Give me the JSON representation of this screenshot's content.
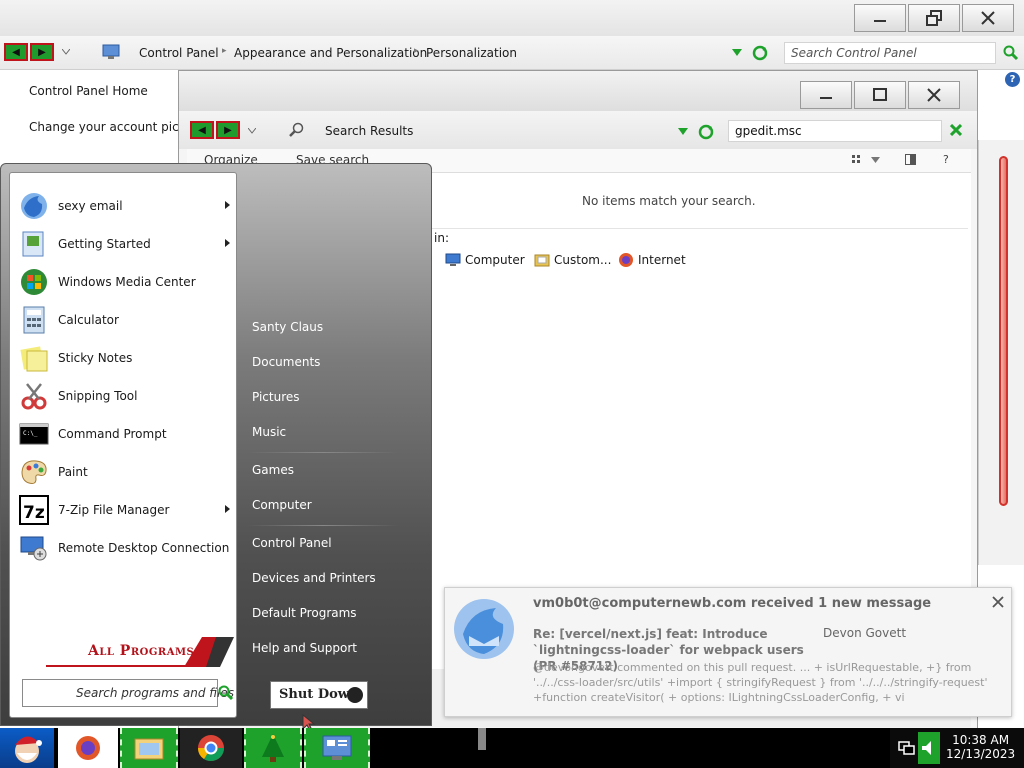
{
  "control_panel": {
    "window_controls": {
      "minimize": "—",
      "restore": "❐",
      "close": "✕"
    },
    "breadcrumb": [
      "Control Panel",
      "Appearance and Personalization",
      "Personalization"
    ],
    "search_placeholder": "Search Control Panel",
    "left_links": [
      "Control Panel Home",
      "Change your account pictur"
    ]
  },
  "search_window": {
    "location": "Search Results",
    "query": "gpedit.msc",
    "toolbar": {
      "organize": "Organize",
      "save_search": "Save search"
    },
    "empty_message": "No items match your search.",
    "search_again_label": "in:",
    "search_again_items": [
      "Computer",
      "Custom...",
      "Internet"
    ]
  },
  "start_menu": {
    "programs": [
      {
        "label": "sexy email",
        "icon": "thunderbird-icon",
        "submenu": true
      },
      {
        "label": "Getting Started",
        "icon": "getting-started-icon",
        "submenu": true
      },
      {
        "label": "Windows Media Center",
        "icon": "media-center-icon",
        "submenu": false
      },
      {
        "label": "Calculator",
        "icon": "calculator-icon",
        "submenu": false
      },
      {
        "label": "Sticky Notes",
        "icon": "sticky-notes-icon",
        "submenu": false
      },
      {
        "label": "Snipping Tool",
        "icon": "snipping-tool-icon",
        "submenu": false
      },
      {
        "label": "Command Prompt",
        "icon": "command-prompt-icon",
        "submenu": false
      },
      {
        "label": "Paint",
        "icon": "paint-icon",
        "submenu": false
      },
      {
        "label": "7-Zip File Manager",
        "icon": "seven-zip-icon",
        "submenu": true
      },
      {
        "label": "Remote Desktop Connection",
        "icon": "remote-desktop-icon",
        "submenu": false
      }
    ],
    "all_programs": "All Programs",
    "search_placeholder": "Search programs and files",
    "right_items": [
      "Santy Claus",
      "Documents",
      "Pictures",
      "Music",
      "Games",
      "Computer",
      "Control Panel",
      "Devices and Printers",
      "Default Programs",
      "Help and Support"
    ],
    "shutdown": "Shut Down"
  },
  "notification": {
    "title": "vm0b0t@computernewb.com received 1 new message",
    "subject": "Re: [vercel/next.js] feat: Introduce `lightningcss-loader` for webpack users (PR #58712)",
    "author": "Devon Govett",
    "body": "@devongovett commented on this pull request. ... + isUrlRequestable, +} from '../../css-loader/src/utils' +import { stringifyRequest } from '../../../stringify-request' +function createVisitor( + options: ILightningCssLoaderConfig, + vi"
  },
  "taskbar": {
    "time": "10:38 AM",
    "date": "12/13/2023"
  },
  "colors": {
    "accent_green": "#1ea22c",
    "accent_red": "#c0141c",
    "start_menu_dark": "#4a4a4a"
  }
}
